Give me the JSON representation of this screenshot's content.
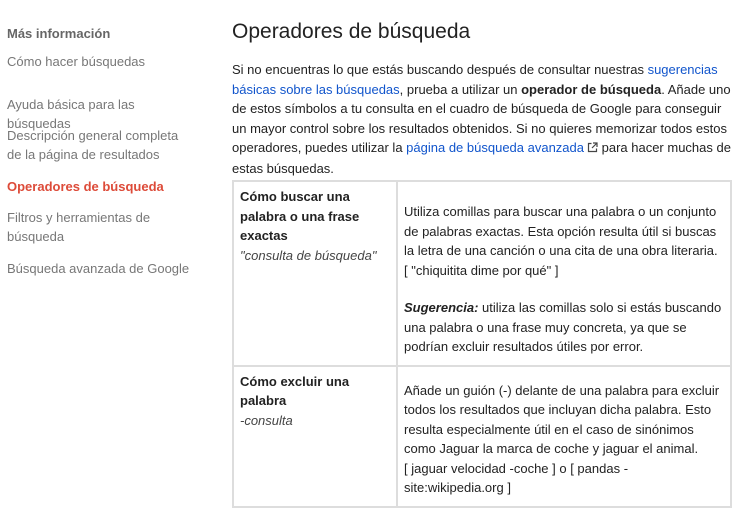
{
  "sidebar": {
    "heading": "Más información",
    "items": [
      {
        "label": "Cómo hacer búsquedas"
      },
      {
        "label": "Ayuda básica para las búsquedas"
      },
      {
        "label": "Descripción general completa de la página de resultados"
      },
      {
        "label": "Operadores de búsqueda"
      },
      {
        "label": "Filtros y herramientas de búsqueda"
      },
      {
        "label": "Búsqueda avanzada de Google"
      }
    ]
  },
  "main": {
    "title": "Operadores de búsqueda",
    "intro": {
      "t1": "Si no encuentras lo que estás buscando después de consultar nuestras ",
      "link1": "sugerencias básicas sobre las búsquedas",
      "t2": ", prueba a utilizar un ",
      "bold": "operador de búsqueda",
      "t3": ". Añade uno de estos símbolos a tu consulta en el cuadro de búsqueda de Google para conseguir un mayor control sobre los resultados obtenidos. Si no quieres memorizar todos estos operadores, puedes utilizar la ",
      "link2": "página de búsqueda avanzada",
      "t4": " para hacer muchas de estas búsquedas."
    },
    "operators": [
      {
        "name": "Cómo buscar una palabra o una frase exactas",
        "example": "\"consulta de búsqueda\"",
        "description": "Utiliza comillas para buscar una palabra o un conjunto de palabras exactas. Esta opción resulta útil si buscas la letra de una canción o una cita de una obra literaria.",
        "sample": "[ \"chiquitita dime por qué\" ]",
        "tip_label": "Sugerencia:",
        "tip_text": " utiliza las comillas solo si estás buscando una palabra o una frase muy concreta, ya que se podrían excluir resultados útiles por error."
      },
      {
        "name": "Cómo excluir una palabra",
        "example": "-consulta",
        "description": "Añade un guión (-) delante de una palabra para excluir todos los resultados que incluyan dicha palabra. Esto resulta especialmente útil en el caso de sinónimos como Jaguar la marca de coche y jaguar el animal.",
        "sample": "[ jaguar velocidad -coche ] o [ pandas -site:wikipedia.org ]"
      }
    ]
  },
  "colors": {
    "link": "#1155cc",
    "active_nav": "#dd4b39",
    "nav_text": "#777777",
    "border": "#dddddd"
  },
  "icons": {
    "external_link": "external-link-icon"
  }
}
